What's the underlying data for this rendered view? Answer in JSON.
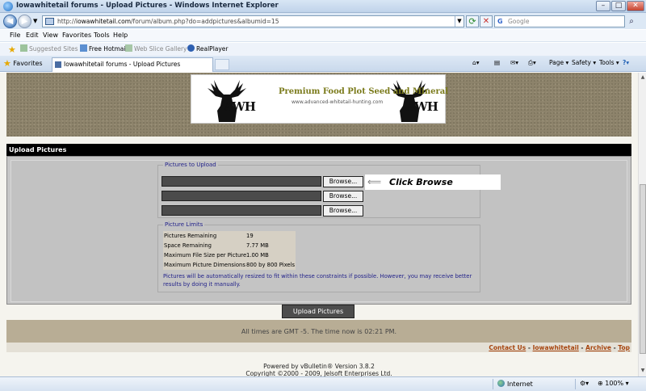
{
  "window": {
    "title": "Iowawhitetail forums - Upload Pictures - Windows Internet Explorer",
    "minimize_glyph": "–",
    "maximize_glyph": "□",
    "close_glyph": "✕"
  },
  "address_bar": {
    "url_prefix": "http://",
    "url_domain": "iowawhitetail.com",
    "url_path": "/forum/album.php?do=addpictures&albumid=15",
    "icon": "page-icon"
  },
  "search_box": {
    "placeholder": "Google",
    "icon": "google-icon"
  },
  "menu": [
    "File",
    "Edit",
    "View",
    "Favorites",
    "Tools",
    "Help"
  ],
  "favorites_bar": {
    "items": [
      {
        "label": "Suggested Sites ▾",
        "icon": "suggested-sites-icon"
      },
      {
        "label": "Free Hotmail",
        "icon": "hotmail-icon"
      },
      {
        "label": "Web Slice Gallery ▾",
        "icon": "web-slice-icon"
      },
      {
        "label": "RealPlayer",
        "icon": "realplayer-icon"
      }
    ]
  },
  "tabs": {
    "favorites_label": "Favorites",
    "active_tab": "Iowawhitetail forums - Upload Pictures"
  },
  "command_bar": {
    "page": "Page ▾",
    "safety": "Safety ▾",
    "tools": "Tools ▾",
    "help": "?▾"
  },
  "banner": {
    "logo_text": "AWH",
    "slogan": "Premium Food Plot Seed and Mineral",
    "website": "www.advanced-whitetail-hunting.com"
  },
  "upload": {
    "section_title": "Upload Pictures",
    "pictures_legend": "Pictures to Upload",
    "browse_label": "Browse...",
    "callout": "Click Browse",
    "limits_legend": "Picture Limits",
    "limits": [
      {
        "key": "Pictures Remaining",
        "value": "19"
      },
      {
        "key": "Space Remaining",
        "value": "7.77 MB"
      },
      {
        "key": "Maximum File Size per Picture",
        "value": "1.00 MB"
      },
      {
        "key": "Maximum Picture Dimensions",
        "value": "800 by 800 Pixels"
      }
    ],
    "note": "Pictures will be automatically resized to fit within these constraints if possible. However, you may receive better results by doing it manually.",
    "submit_label": "Upload Pictures"
  },
  "footer": {
    "time_text": "All times are GMT -5. The time now is 02:21 PM.",
    "links": [
      "Contact Us",
      "Iowawhitetail",
      "Archive",
      "Top"
    ],
    "powered_line1": "Powered by vBulletin® Version 3.8.2",
    "powered_line2": "Copyright ©2000 - 2009, Jelsoft Enterprises Ltd."
  },
  "status_bar": {
    "zone": "Internet",
    "zoom": "100%"
  }
}
